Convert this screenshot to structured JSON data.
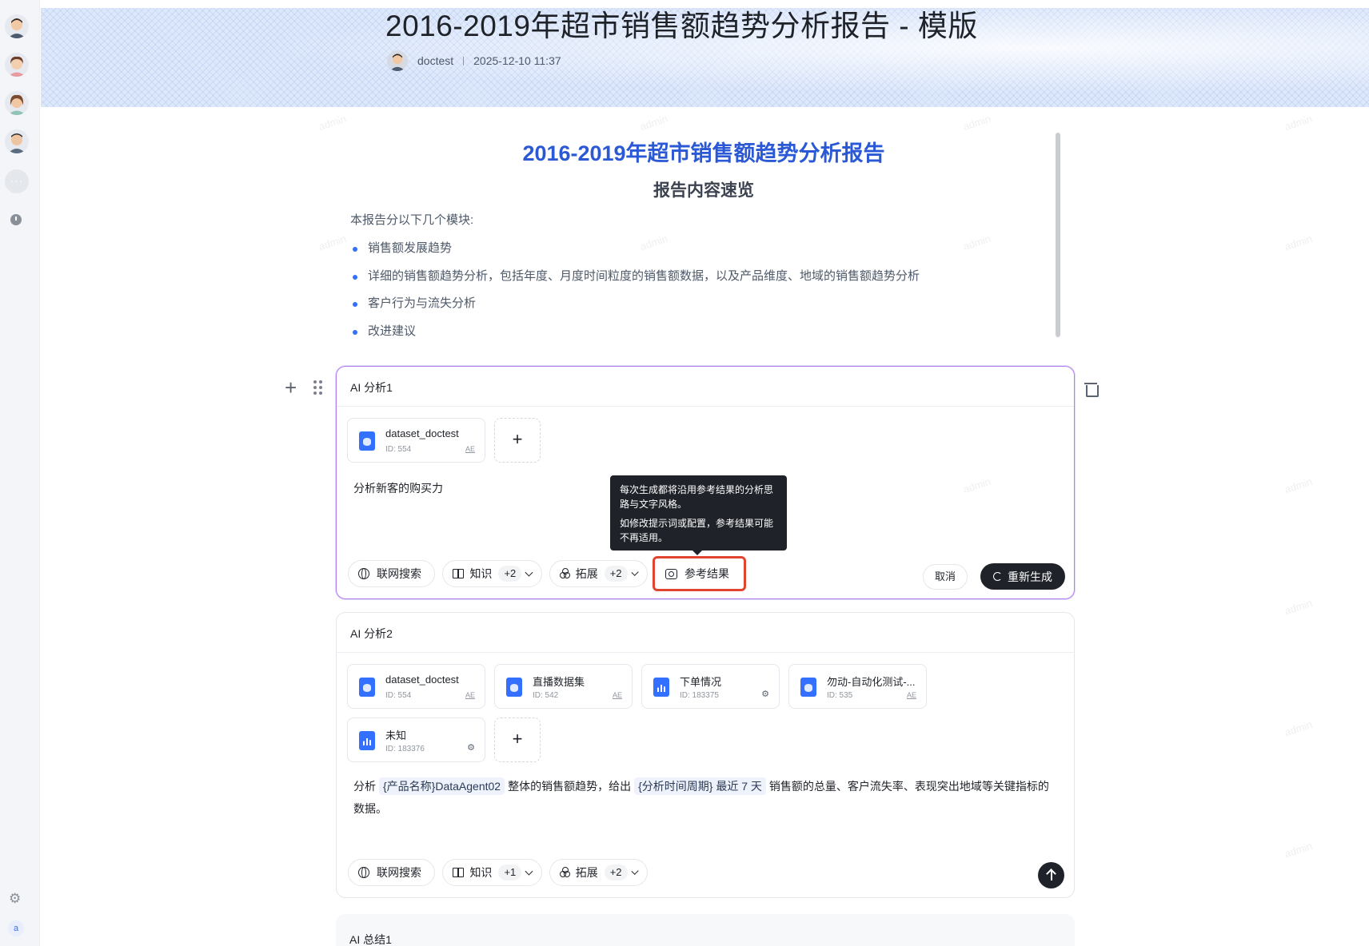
{
  "header": {
    "title": "2016-2019年超市销售额趋势分析报告 - 模版",
    "author": "doctest",
    "timestamp": "2025-12-10 11:37"
  },
  "report": {
    "title": "2016-2019年超市销售额趋势分析报告",
    "subtitle": "报告内容速览",
    "intro": "本报告分以下几个模块:",
    "items": [
      "销售额发展趋势",
      "详细的销售额趋势分析，包括年度、月度时间粒度的销售额数据，以及产品维度、地域的销售额趋势分析",
      "客户行为与流失分析",
      "改进建议"
    ]
  },
  "analysis1": {
    "title": "AI 分析1",
    "datasets": [
      {
        "name": "dataset_doctest",
        "id": "ID: 554",
        "icon": "database-icon",
        "tag": "AE"
      }
    ],
    "prompt": "分析新客的购买力",
    "toolbar": {
      "web_search": "联网搜索",
      "knowledge": "知识",
      "knowledge_count": "+2",
      "extend": "拓展",
      "extend_count": "+2",
      "reference": "参考结果"
    },
    "cancel": "取消",
    "regenerate": "重新生成",
    "tooltip": {
      "line1": "每次生成都将沿用参考结果的分析思路与文字风格。",
      "line2": "如修改提示词或配置，参考结果可能不再适用。"
    }
  },
  "analysis2": {
    "title": "AI 分析2",
    "datasets": [
      {
        "name": "dataset_doctest",
        "id": "ID: 554",
        "icon": "database-icon",
        "tag": "AE"
      },
      {
        "name": "直播数据集",
        "id": "ID: 542",
        "icon": "database-icon",
        "tag": "AE"
      },
      {
        "name": "下单情况",
        "id": "ID: 183375",
        "icon": "chart-icon",
        "tag": "⚙"
      },
      {
        "name": "勿动-自动化测试-...",
        "id": "ID: 535",
        "icon": "database-icon",
        "tag": "AE"
      },
      {
        "name": "未知",
        "id": "ID: 183376",
        "icon": "chart-icon",
        "tag": "⚙"
      }
    ],
    "prompt": {
      "p1": "分析",
      "v1": "{产品名称}DataAgent02",
      "p2": "整体的销售额趋势，给出",
      "v2": "{分析时间周期} 最近 7 天",
      "p3": "销售额的总量、客户流失率、表现突出地域等关键指标的数据。"
    },
    "toolbar": {
      "web_search": "联网搜索",
      "knowledge": "知识",
      "knowledge_count": "+1",
      "extend": "拓展",
      "extend_count": "+2"
    }
  },
  "summary1": {
    "title": "AI 总结1"
  },
  "sidebar": {
    "user_initial": "a"
  },
  "watermark": "admin",
  "colors": {
    "accent": "#3370ff",
    "report_title": "#2b59d6",
    "active_border": "#b77cf3",
    "highlight": "#e2452f",
    "dark_button": "#1f2329"
  }
}
